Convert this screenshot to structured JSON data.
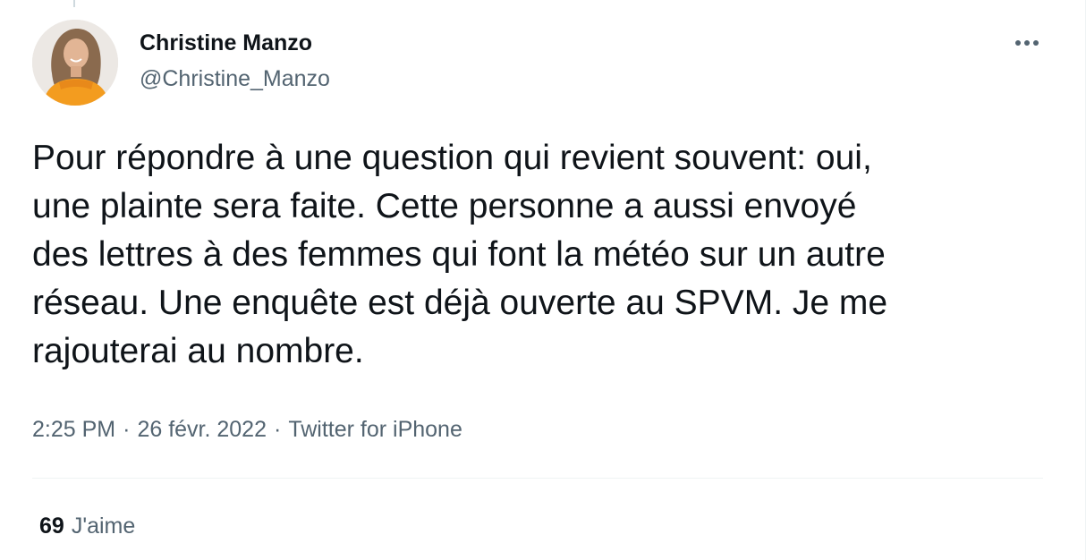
{
  "author": {
    "name": "Christine Manzo",
    "handle": "@Christine_Manzo"
  },
  "tweet": {
    "lines": [
      "Pour répondre à une question qui revient souvent: oui,",
      "une plainte sera faite. Cette personne a aussi envoyé",
      "des lettres à des femmes qui font la météo sur un autre",
      "réseau. Une enquête est déjà ouverte au SPVM. Je me",
      "rajouterai au nombre."
    ]
  },
  "meta": {
    "time": "2:25 PM",
    "separator": "·",
    "date": "26 févr. 2022",
    "source": "Twitter for iPhone"
  },
  "stats": {
    "likes_count": "69",
    "likes_label": "J'aime"
  },
  "icons": {
    "more": "more-horizontal-icon"
  },
  "colors": {
    "text_primary": "#0f1419",
    "text_secondary": "#536471",
    "divider": "#eff3f4",
    "avatar_top": "#f39c1f"
  }
}
